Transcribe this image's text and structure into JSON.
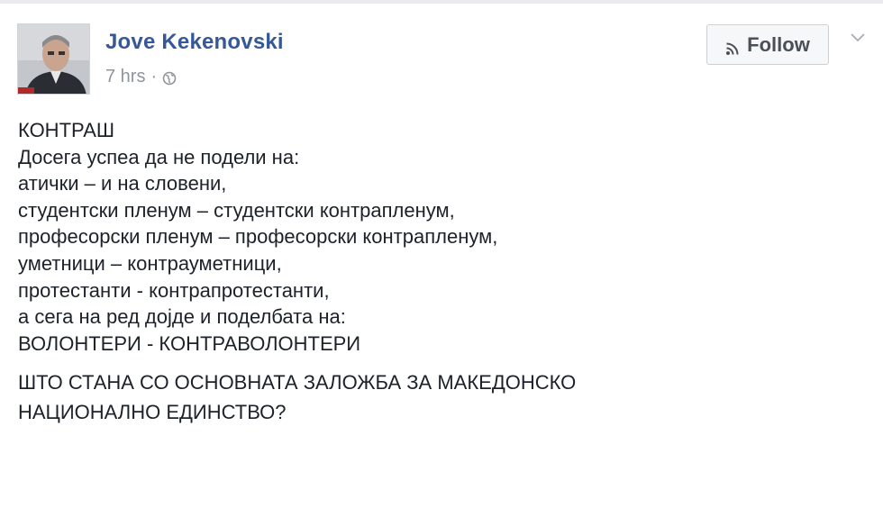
{
  "post": {
    "author": {
      "name": "Jove Kekenovski",
      "avatar_alt": "profile photo"
    },
    "time": "7 hrs",
    "separator": "·",
    "privacy_icon": "globe-icon",
    "follow_label": "Follow",
    "follow_icon": "rss-icon",
    "options_icon": "chevron-down-icon",
    "paragraphs": [
      {
        "lines": [
          "КОНТРАШ",
          "Досега успеа да не подели на:",
          "атички – и на словени,",
          "студентски пленум – студентски контрапленум,",
          "професорски пленум – професорски контрапленум,",
          "уметници – контрауметници,",
          "протестанти - контрапротестанти,",
          "а сега на ред дојде и поделбата на:",
          "ВОЛОНТЕРИ - КОНТРАВОЛОНТЕРИ"
        ]
      },
      {
        "lines": [
          "ШТО СТАНА СО ОСНОВНАТА ЗАЛОЖБА ЗА МАКЕДОНСКО",
          "НАЦИОНАЛНО ЕДИНСТВО?"
        ]
      }
    ]
  },
  "colors": {
    "author_link": "#365899",
    "meta_text": "#90949c",
    "body_text": "#1d2129",
    "button_bg": "#f6f7f9",
    "button_border": "#ced0d4"
  }
}
